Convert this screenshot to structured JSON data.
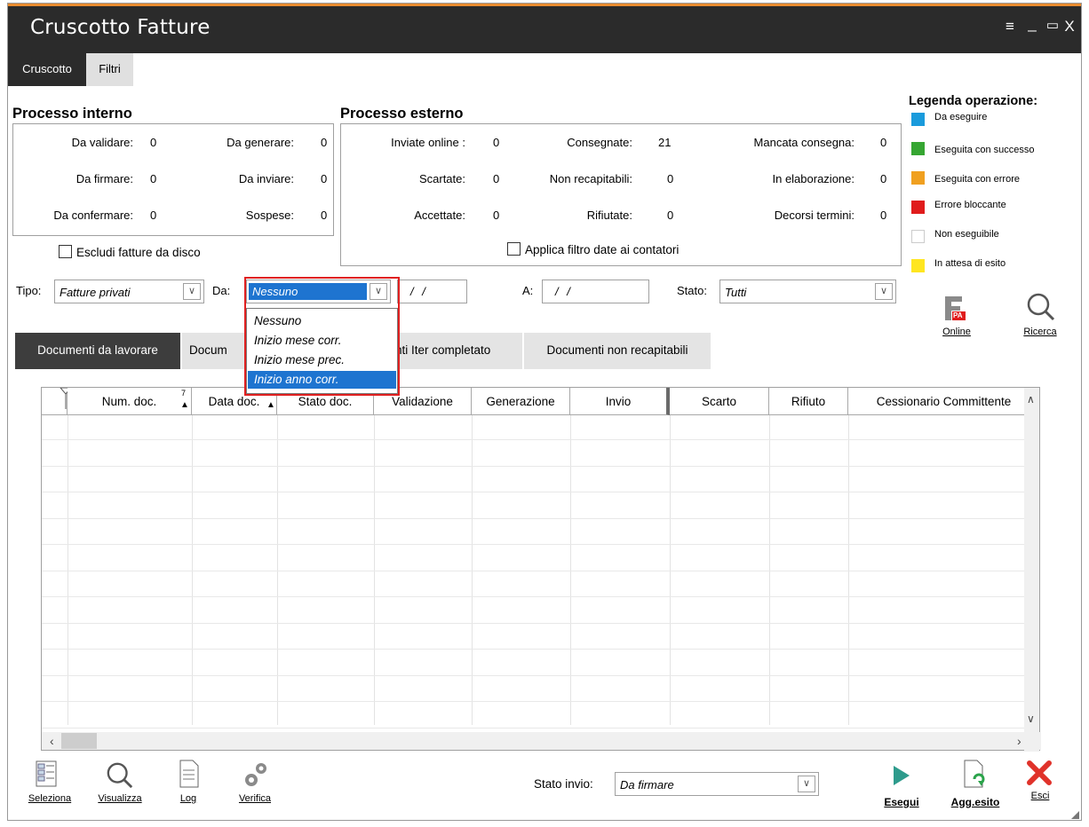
{
  "window": {
    "title": "Cruscotto Fatture",
    "menu_icon": "≡",
    "minimize_icon": "_",
    "maximize_icon": "▭",
    "close_icon": "X"
  },
  "main_tabs": [
    "Cruscotto",
    "Filtri"
  ],
  "interno": {
    "title": "Processo interno",
    "rows": [
      [
        "Da validare:",
        "0",
        "Da generare:",
        "0"
      ],
      [
        "Da firmare:",
        "0",
        "Da inviare:",
        "0"
      ],
      [
        "Da confermare:",
        "0",
        "Sospese:",
        "0"
      ]
    ],
    "escludi_label": "Escludi fatture da disco"
  },
  "esterno": {
    "title": "Processo esterno",
    "rows": [
      [
        "Inviate online :",
        "0",
        "Consegnate:",
        "21",
        "Mancata consegna:",
        "0"
      ],
      [
        "Scartate:",
        "0",
        "Non recapitabili:",
        "0",
        "In elaborazione:",
        "0"
      ],
      [
        "Accettate:",
        "0",
        "Rifiutate:",
        "0",
        "Decorsi termini:",
        "0"
      ]
    ],
    "filtro_label": "Applica filtro date ai contatori"
  },
  "legend": {
    "title": "Legenda operazione:",
    "items": [
      {
        "color": "#1a9bdc",
        "label": "Da eseguire"
      },
      {
        "color": "#36a632",
        "label": "Eseguita con successo"
      },
      {
        "color": "#f0a020",
        "label": "Eseguita con errore"
      },
      {
        "color": "#e01c1c",
        "label": "Errore bloccante"
      },
      {
        "color": "#ffffff",
        "label": "Non eseguibile"
      },
      {
        "color": "#ffe620",
        "label": "In attesa di esito"
      }
    ]
  },
  "filters": {
    "tipo_label": "Tipo:",
    "tipo_value": "Fatture privati",
    "da_label": "Da:",
    "da_value": "Nessuno",
    "date_from": "/ /",
    "a_label": "A:",
    "date_to": "/ /",
    "stato_label": "Stato:",
    "stato_value": "Tutti",
    "dropdown_options": [
      "Nessuno",
      "Inizio mese corr.",
      "Inizio mese prec.",
      "Inizio anno corr."
    ],
    "dropdown_selected": 3
  },
  "side_tools": {
    "online_label": "Online",
    "ricerca_label": "Ricerca",
    "fpa_text": "PA"
  },
  "doc_tabs": [
    "Documenti da lavorare",
    "Docum",
    "nti Iter completato",
    "Documenti non recapitabili"
  ],
  "grid": {
    "columns": [
      "Num. doc.",
      "Data doc.",
      "Stato doc.",
      "Validazione",
      "Generazione",
      "Invio",
      "Scarto",
      "Rifiuto",
      "Cessionario Committente"
    ],
    "sort_mark": "7"
  },
  "footer": {
    "tools": [
      "Seleziona",
      "Visualizza",
      "Log",
      "Verifica"
    ],
    "stato_invio_label": "Stato invio:",
    "stato_invio_value": "Da firmare",
    "actions": [
      "Esegui",
      "Agg.esito",
      "Esci"
    ]
  }
}
